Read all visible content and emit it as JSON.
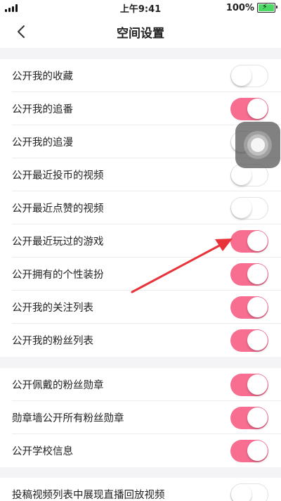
{
  "status_bar": {
    "time": "上午9:41",
    "battery_percent": "100%",
    "battery_level": 1.0
  },
  "nav": {
    "title": "空间设置",
    "back_icon": "chevron-left-icon"
  },
  "colors": {
    "toggle_on": "#f76e91",
    "section_gap": "#f4f4f7",
    "annotation_arrow": "#e8333a",
    "battery_fill": "#4cd964"
  },
  "groups": [
    {
      "rows": [
        {
          "label": "公开我的收藏",
          "on": false
        },
        {
          "label": "公开我的追番",
          "on": true
        },
        {
          "label": "公开我的追漫",
          "on": false
        },
        {
          "label": "公开最近投币的视频",
          "on": false
        },
        {
          "label": "公开最近点赞的视频",
          "on": false
        },
        {
          "label": "公开最近玩过的游戏",
          "on": true
        },
        {
          "label": "公开拥有的个性装扮",
          "on": true
        },
        {
          "label": "公开我的关注列表",
          "on": true
        },
        {
          "label": "公开我的粉丝列表",
          "on": true
        }
      ]
    },
    {
      "rows": [
        {
          "label": "公开佩戴的粉丝勋章",
          "on": true
        },
        {
          "label": "勋章墙公开所有粉丝勋章",
          "on": true
        },
        {
          "label": "公开学校信息",
          "on": true
        }
      ]
    },
    {
      "rows": [
        {
          "label": "投稿视频列表中展现直播回放视频",
          "on": false
        }
      ]
    }
  ]
}
